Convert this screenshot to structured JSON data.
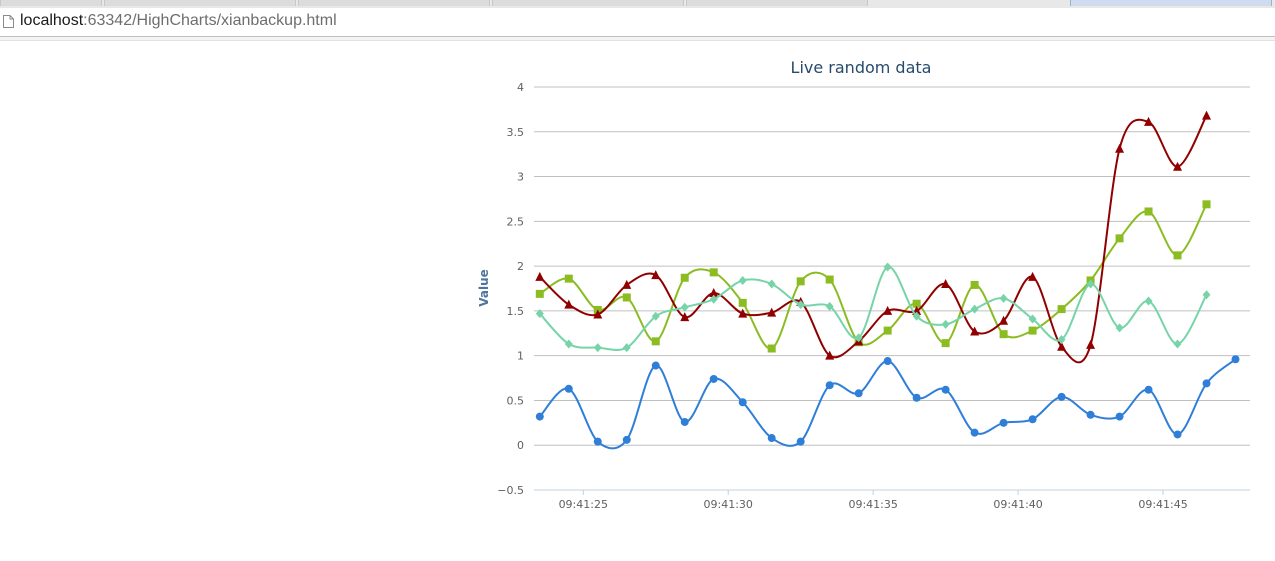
{
  "browser": {
    "url_host": "localhost",
    "url_rest": ":63342/HighCharts/xianbackup.html"
  },
  "chart_data": {
    "type": "line",
    "title": "Live random data",
    "ylabel": "Value",
    "xlabel": "",
    "ylim": [
      -0.5,
      4
    ],
    "yticks": [
      -0.5,
      0,
      0.5,
      1,
      1.5,
      2,
      2.5,
      3,
      3.5,
      4
    ],
    "ytick_labels": [
      "−0.5",
      "0",
      "0.5",
      "1",
      "1.5",
      "2",
      "2.5",
      "3",
      "3.5",
      "4"
    ],
    "x_seconds": [
      23.5,
      24.5,
      25.5,
      26.5,
      27.5,
      28.5,
      29.5,
      30.5,
      31.5,
      32.5,
      33.5,
      34.5,
      35.5,
      36.5,
      37.5,
      38.5,
      39.5,
      40.5,
      41.5,
      42.5,
      43.5,
      44.5,
      45.5,
      46.5,
      47.5
    ],
    "xlim_seconds": [
      23.3,
      48.0
    ],
    "xticks": [
      "09:41:25",
      "09:41:30",
      "09:41:35",
      "09:41:40",
      "09:41:45"
    ],
    "xtick_seconds": [
      25,
      30,
      35,
      40,
      45
    ],
    "grid": true,
    "legend": "none",
    "series": [
      {
        "color": "#2f7ed8",
        "marker": "circle",
        "values": [
          0.32,
          0.63,
          0.04,
          0.06,
          0.89,
          0.26,
          0.74,
          0.48,
          0.08,
          0.04,
          0.67,
          0.58,
          0.94,
          0.53,
          0.62,
          0.14,
          0.25,
          0.29,
          0.54,
          0.34,
          0.32,
          0.62,
          0.12,
          0.69,
          0.96
        ]
      },
      {
        "color": "#8bbc21",
        "marker": "square",
        "values": [
          1.69,
          1.86,
          1.51,
          1.65,
          1.16,
          1.87,
          1.93,
          1.59,
          1.08,
          1.83,
          1.85,
          1.15,
          1.28,
          1.58,
          1.14,
          1.79,
          1.24,
          1.28,
          1.52,
          1.84,
          2.31,
          2.61,
          2.12,
          2.69
        ]
      },
      {
        "color": "#910000",
        "marker": "triangle",
        "values": [
          1.88,
          1.57,
          1.46,
          1.79,
          1.9,
          1.43,
          1.7,
          1.47,
          1.48,
          1.6,
          1.0,
          1.16,
          1.5,
          1.5,
          1.8,
          1.27,
          1.39,
          1.88,
          1.1,
          1.12,
          3.31,
          3.61,
          3.11,
          3.68
        ]
      },
      {
        "color": "#77d4a8",
        "marker": "diamond",
        "values": [
          1.47,
          1.13,
          1.09,
          1.09,
          1.44,
          1.54,
          1.63,
          1.84,
          1.8,
          1.57,
          1.55,
          1.2,
          1.99,
          1.44,
          1.35,
          1.52,
          1.64,
          1.41,
          1.18,
          1.8,
          1.31,
          1.61,
          1.13,
          1.68
        ]
      }
    ]
  }
}
